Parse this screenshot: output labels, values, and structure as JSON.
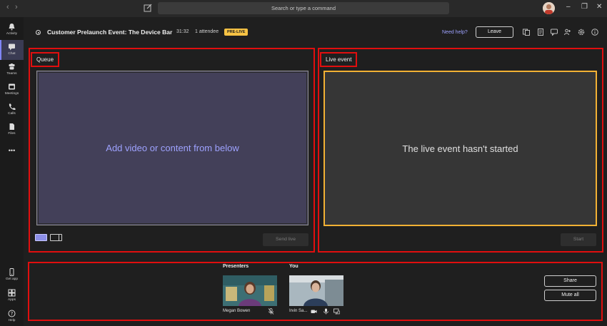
{
  "titlebar": {
    "search_placeholder": "Search or type a command"
  },
  "rail": {
    "items": [
      {
        "label": "Activity",
        "icon": "bell-icon"
      },
      {
        "label": "Chat",
        "icon": "chat-icon"
      },
      {
        "label": "Teams",
        "icon": "teams-icon"
      },
      {
        "label": "Meetings",
        "icon": "calendar-icon"
      },
      {
        "label": "Calls",
        "icon": "phone-icon"
      },
      {
        "label": "Files",
        "icon": "file-icon"
      }
    ],
    "more": "•••",
    "bottom_items": [
      {
        "label": "Get app",
        "icon": "phone-device-icon"
      },
      {
        "label": "Apps",
        "icon": "apps-icon"
      },
      {
        "label": "Help",
        "icon": "help-icon"
      }
    ],
    "active_index": 1
  },
  "meeting": {
    "title": "Customer Prelaunch Event: The Device Bar",
    "time": "31:32",
    "attendees": "1 attendee",
    "status_badge": "PRE-LIVE",
    "need_help": "Need help?",
    "leave_label": "Leave",
    "badge_color": "#f6c244",
    "accent_color": "#9ea2ff"
  },
  "queue": {
    "title": "Queue",
    "placeholder": "Add video or content from below",
    "send_live_label": "Send live"
  },
  "live_event": {
    "title": "Live event",
    "message": "The live event hasn't started",
    "start_label": "Start",
    "border_color": "#f2b134"
  },
  "presenters": {
    "presenters_label": "Presenters",
    "you_label": "You",
    "people": [
      {
        "name": "Megan Bowen"
      },
      {
        "name": "Irvin Sa..."
      }
    ],
    "share_label": "Share",
    "mute_all_label": "Mute all"
  }
}
